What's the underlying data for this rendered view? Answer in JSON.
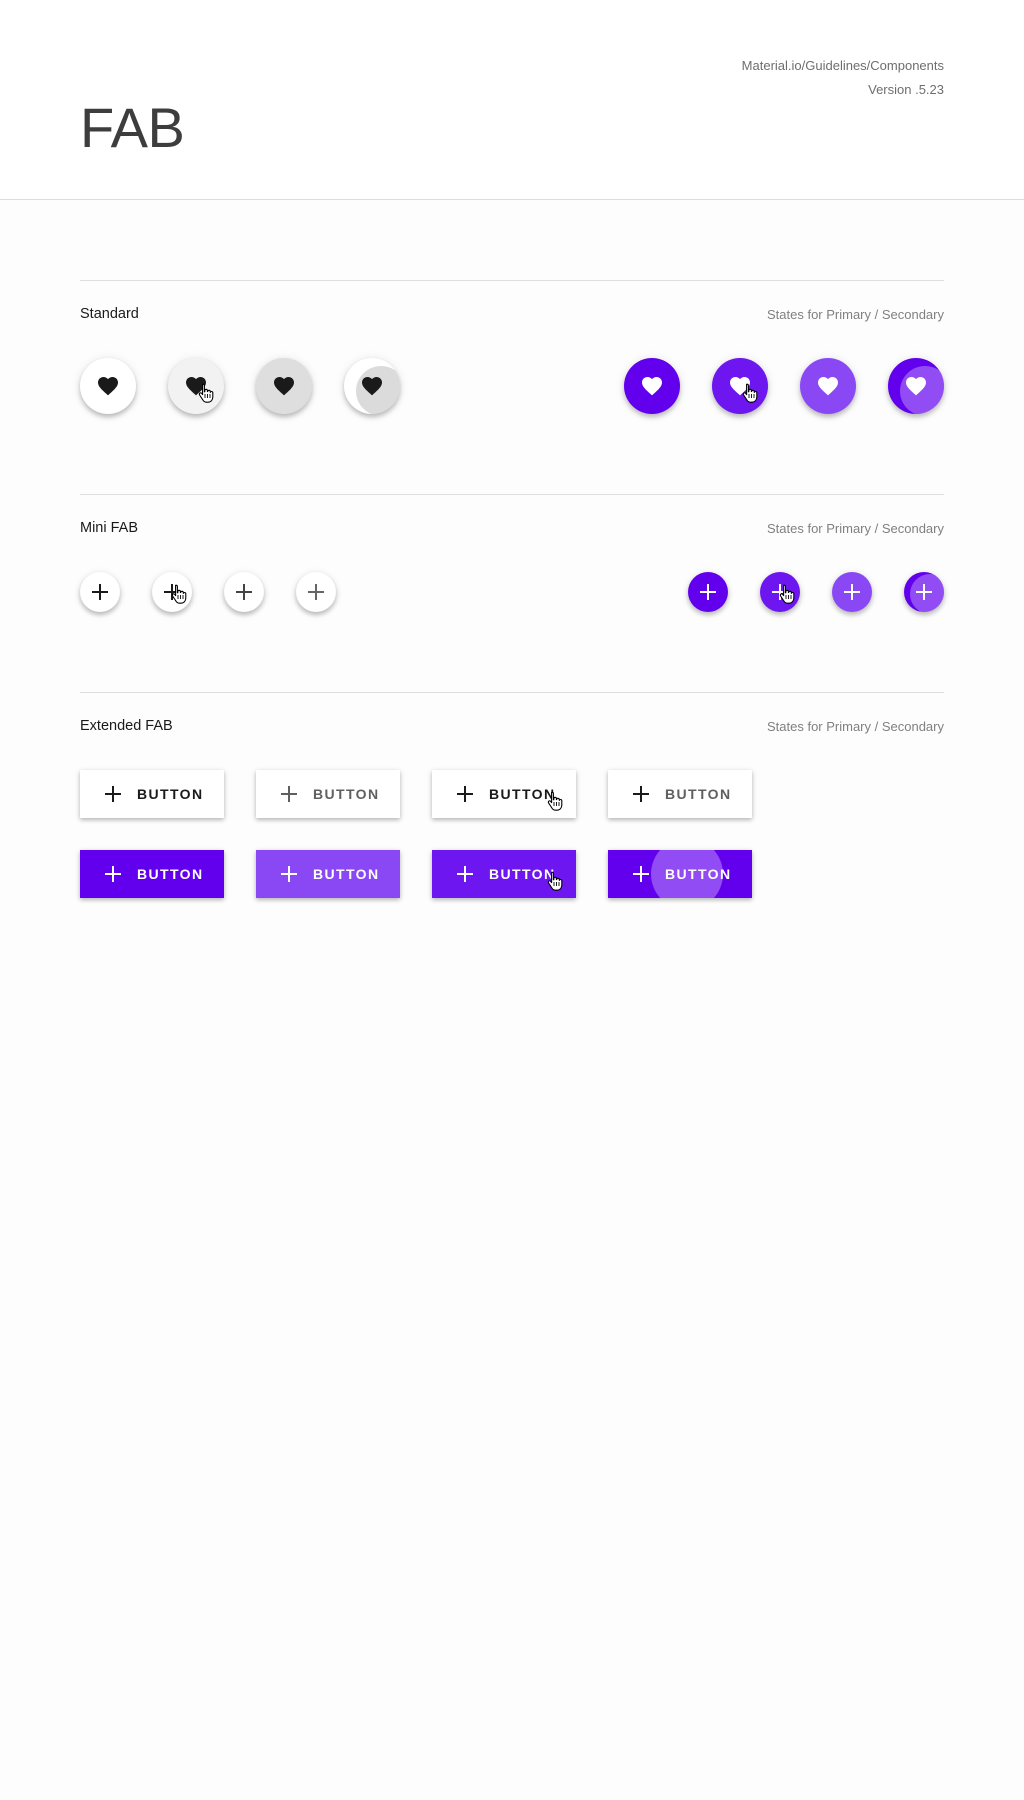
{
  "header": {
    "title": "FAB",
    "source": "Material.io/Guidelines/Components",
    "version": "Version .5.23"
  },
  "sections": {
    "standard": {
      "title": "Standard",
      "subtitle": "States for Primary / Secondary"
    },
    "mini": {
      "title": "Mini FAB",
      "subtitle": "States for Primary / Secondary"
    },
    "extended": {
      "title": "Extended FAB",
      "subtitle": "States for Primary / Secondary"
    }
  },
  "extended_fab": {
    "label": "BUTTON"
  },
  "colors": {
    "primary": "#6200ee",
    "primary_focus": "#8a48f5",
    "surface": "#ffffff",
    "icon_dark": "#1a1a1a"
  },
  "icons": {
    "standard": "heart-icon",
    "mini": "plus-icon",
    "extended": "plus-icon",
    "cursor": "hand-pointer-icon"
  },
  "states": [
    "enabled",
    "hover",
    "focused",
    "pressed"
  ]
}
